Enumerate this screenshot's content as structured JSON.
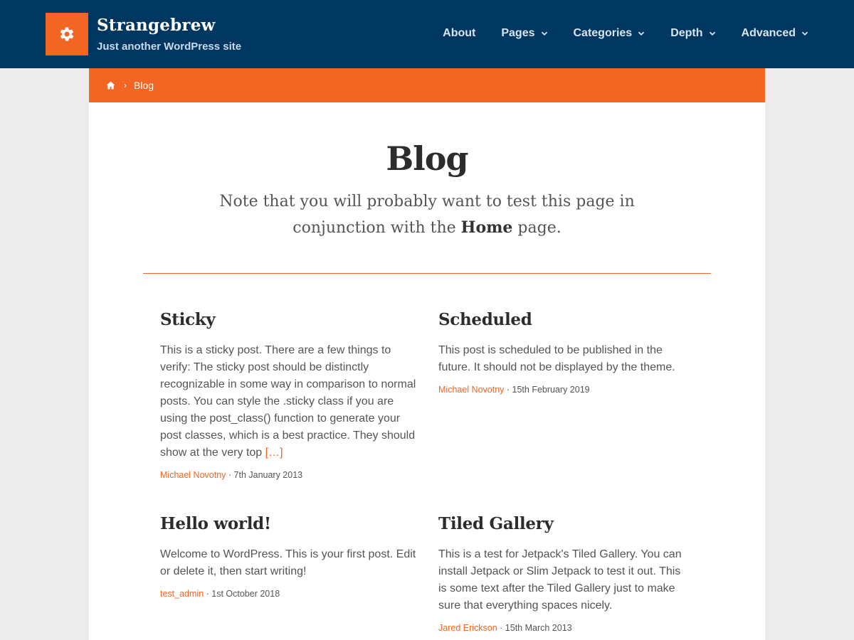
{
  "site": {
    "title": "Strangebrew",
    "tagline": "Just another WordPress site",
    "logo_icon": "gear-icon",
    "colors": {
      "header_bg": "#003760",
      "accent": "#f26522"
    }
  },
  "nav": {
    "items": [
      {
        "label": "About",
        "dropdown": false
      },
      {
        "label": "Pages",
        "dropdown": true
      },
      {
        "label": "Categories",
        "dropdown": true
      },
      {
        "label": "Depth",
        "dropdown": true
      },
      {
        "label": "Advanced",
        "dropdown": true
      }
    ]
  },
  "breadcrumb": {
    "home_icon": "home-icon",
    "current": "Blog"
  },
  "page": {
    "title": "Blog",
    "intro_before": "Note that you will probably want to test this page in conjunction with the ",
    "intro_bold": "Home",
    "intro_after": " page."
  },
  "posts": [
    {
      "title": "Sticky",
      "excerpt": "This is a sticky post. There are a few things to verify: The sticky post should be distinctly recognizable in some way in comparison to normal posts. You can style the .sticky class if you are using the post_class() function to generate your post classes, which is a best practice. They should show at the very top",
      "more": "[…]",
      "author": "Michael Novotny",
      "date": "7th January 2013"
    },
    {
      "title": "Scheduled",
      "excerpt": "This post is scheduled to be published in the future. It should not be displayed by the theme.",
      "more": "",
      "author": "Michael Novotny",
      "date": "15th February 2019"
    },
    {
      "title": "Hello world!",
      "excerpt": "Welcome to WordPress. This is your first post. Edit or delete it, then start writing!",
      "more": "",
      "author": "test_admin",
      "date": "1st October 2018"
    },
    {
      "title": "Tiled Gallery",
      "excerpt": "This is a test for Jetpack's Tiled Gallery. You can install Jetpack or Slim Jetpack to test it out. This is some text after the Tiled Gallery just to make sure that everything spaces nicely.",
      "more": "",
      "author": "Jared Erickson",
      "date": "15th March 2013"
    }
  ],
  "meta_separator": " · "
}
